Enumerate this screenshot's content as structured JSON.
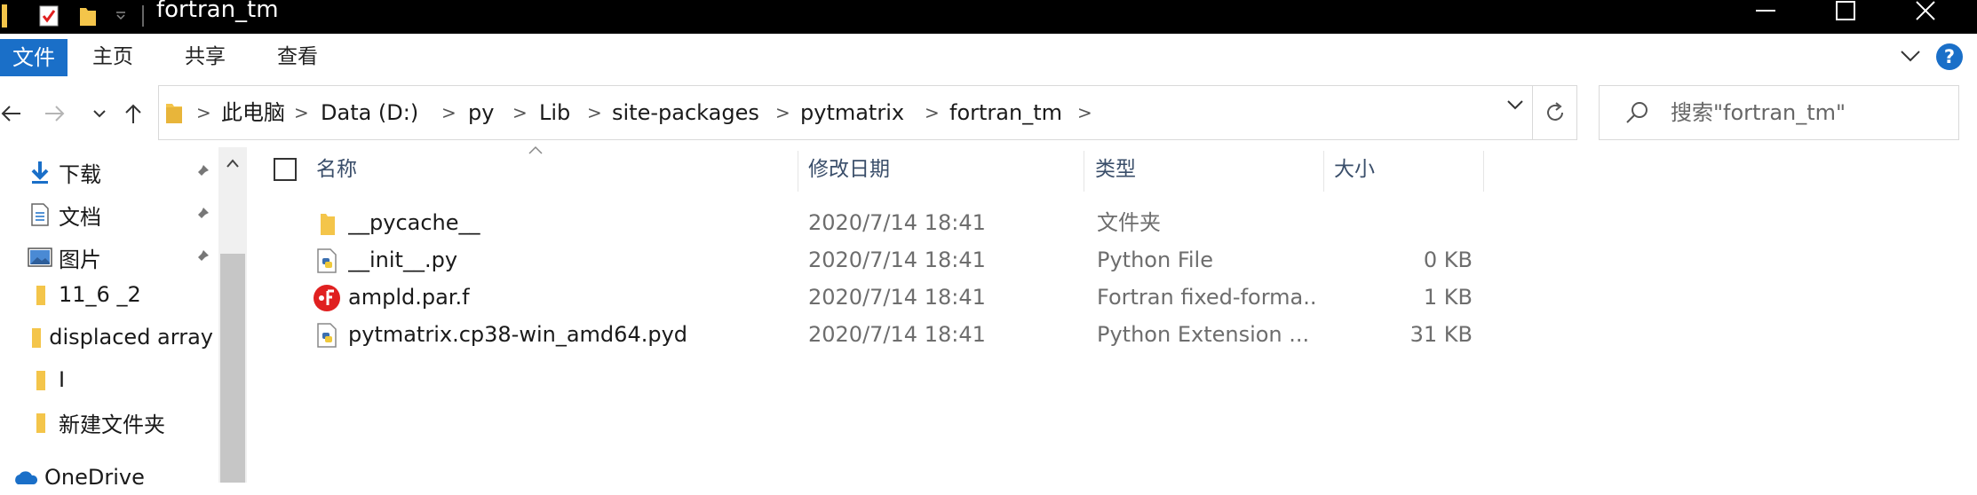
{
  "window": {
    "title": "fortran_tm"
  },
  "ribbon": {
    "tabs": [
      "文件",
      "主页",
      "共享",
      "查看"
    ],
    "help_label": "?"
  },
  "address": {
    "crumbs": [
      "此电脑",
      "Data (D:)",
      "py",
      "Lib",
      "site-packages",
      "pytmatrix",
      "fortran_tm"
    ]
  },
  "search": {
    "placeholder": "搜索\"fortran_tm\""
  },
  "navpane": {
    "items": [
      {
        "label": "下载",
        "icon": "download-icon",
        "pinned": true
      },
      {
        "label": "文档",
        "icon": "document-icon",
        "pinned": true
      },
      {
        "label": "图片",
        "icon": "picture-icon",
        "pinned": true
      },
      {
        "label": "11_6 _2",
        "icon": "folder-icon",
        "pinned": false
      },
      {
        "label": "displaced array",
        "icon": "folder-icon",
        "pinned": false
      },
      {
        "label": "I",
        "icon": "folder-icon",
        "pinned": false
      },
      {
        "label": "新建文件夹",
        "icon": "folder-icon",
        "pinned": false
      },
      {
        "label": "OneDrive",
        "icon": "onedrive-icon",
        "pinned": false
      }
    ]
  },
  "columns": {
    "name": "名称",
    "date": "修改日期",
    "type": "类型",
    "size": "大小"
  },
  "files": [
    {
      "name": "__pycache__",
      "date": "2020/7/14 18:41",
      "type": "文件夹",
      "size": "",
      "icon": "folder-icon"
    },
    {
      "name": "__init__.py",
      "date": "2020/7/14 18:41",
      "type": "Python File",
      "size": "0 KB",
      "icon": "python-file-icon"
    },
    {
      "name": "ampld.par.f",
      "date": "2020/7/14 18:41",
      "type": "Fortran fixed-forma...",
      "size": "1 KB",
      "icon": "fortran-file-icon"
    },
    {
      "name": "pytmatrix.cp38-win_amd64.pyd",
      "date": "2020/7/14 18:41",
      "type": "Python Extension ...",
      "size": "31 KB",
      "icon": "python-extension-icon"
    }
  ],
  "colors": {
    "accent": "#1a6fc8",
    "folder": "#f4c54a",
    "fortran": "#e02020"
  }
}
